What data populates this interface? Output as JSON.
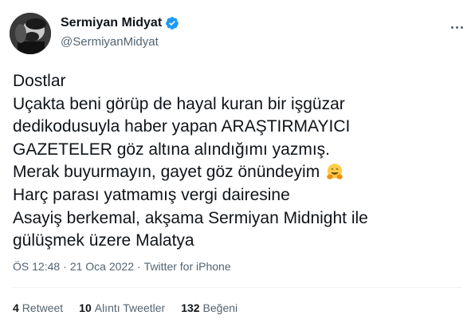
{
  "author": {
    "display_name": "Sermiyan Midyat",
    "handle": "@SermiyanMidyat",
    "verified": true,
    "verified_color": "#1d9bf0"
  },
  "tweet": {
    "lines": [
      "Dostlar",
      "Uçakta beni görüp de hayal kuran bir işgüzar",
      "dedikodusuyla haber yapan ARAŞTIRMAYICI",
      "GAZETELER göz altına alındığımı yazmış.",
      "Merak buyurmayın, gayet göz önündeyim",
      "Harç parası yatmamış vergi dairesine",
      "Asayiş berkemal, akşama Sermiyan Midnight ile",
      "gülüşmek üzere Malatya"
    ],
    "emoji": "hugging-face-emoji"
  },
  "meta": {
    "time": "ÖS 12:48",
    "separator": "·",
    "date": "21 Oca 2022",
    "source": "Twitter for iPhone"
  },
  "stats": {
    "retweets_count": "4",
    "retweets_label": "Retweet",
    "quotes_count": "10",
    "quotes_label": "Alıntı Tweetler",
    "likes_count": "132",
    "likes_label": "Beğeni"
  },
  "icons": {
    "more": "more-horizontal-icon",
    "verified": "verified-badge-icon",
    "avatar": "avatar"
  }
}
